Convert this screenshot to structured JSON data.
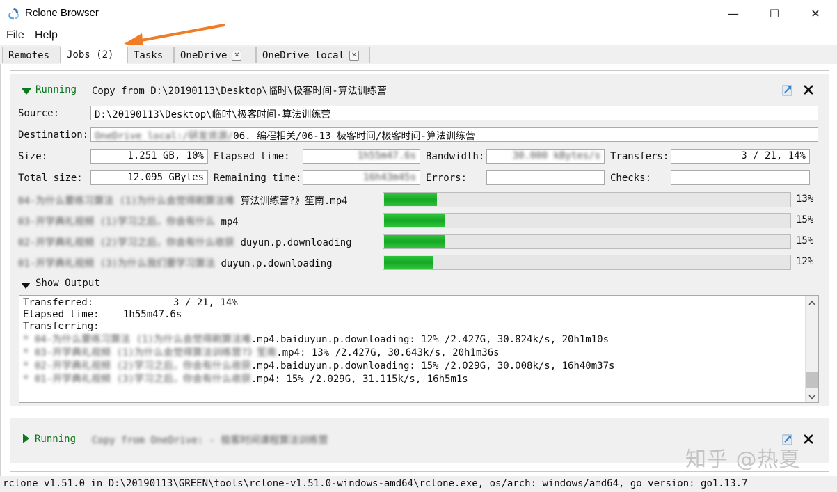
{
  "window": {
    "title": "Rclone Browser",
    "controls": [
      "—",
      "☐",
      "✕"
    ]
  },
  "menu": [
    {
      "label": "File",
      "accel": "F"
    },
    {
      "label": "Help",
      "accel": "H"
    }
  ],
  "tabs": [
    {
      "label": "Remotes",
      "closable": false,
      "active": false
    },
    {
      "label": "Jobs (2)",
      "closable": false,
      "active": true
    },
    {
      "label": "Tasks",
      "closable": false,
      "active": false
    },
    {
      "label": "OneDrive",
      "closable": true,
      "active": false
    },
    {
      "label": "OneDrive_local",
      "closable": true,
      "active": false
    }
  ],
  "colors": {
    "running_green": "#0a7a1d",
    "progress_green": "#15a824",
    "annotation_arrow": "#f07c26"
  },
  "job1": {
    "status": "Running",
    "title": "Copy from D:\\20190113\\Desktop\\临时\\极客时间-算法训练营",
    "source_label": "Source:",
    "source": "D:\\20190113\\Desktop\\临时\\极客时间-算法训练营",
    "destination_label": "Destination:",
    "destination_blurred": "OneDrive_local:/研发资源/",
    "destination": "06. 编程相关/06-13 极客时间/极客时间-算法训练营",
    "size_label": "Size:",
    "size": "1.251 GB, 10%",
    "elapsed_label": "Elapsed time:",
    "elapsed_blurred": "1h55m47.6s",
    "bandwidth_label": "Bandwidth:",
    "bandwidth_blurred": "30.000 kBytes/s",
    "transfers_label": "Transfers:",
    "transfers": "3 / 21, 14%",
    "total_size_label": "Total size:",
    "total_size": "12.095 GBytes",
    "remaining_label": "Remaining time:",
    "remaining_blurred": "16h43m45s",
    "errors_label": "Errors:",
    "errors": "",
    "checks_label": "Checks:",
    "checks": "",
    "files": [
      {
        "blurred": "04-为什么要练习算法 (1)为什么会觉得刷算法难",
        "visible": "算法训练营?》笙南.mp4",
        "progress": 13,
        "pct": "13%"
      },
      {
        "blurred": "03-开学典礼视频 (1)学习之后，你会有什么",
        "visible": "mp4",
        "progress": 15,
        "pct": "15%"
      },
      {
        "blurred": "02-开学典礼视频 (2)学习之后，你会有什么收获",
        "visible": "duyun.p.downloading",
        "progress": 15,
        "pct": "15%"
      },
      {
        "blurred": "01-开学典礼视频 (3)为什么我们要学习算法",
        "visible": "duyun.p.downloading",
        "progress": 12,
        "pct": "12%"
      }
    ],
    "show_output_label": "Show Output",
    "output": {
      "transferred_label": "Transferred:",
      "transferred_value": "3 / 21, 14%",
      "elapsed_label": "Elapsed time:",
      "elapsed_value": "1h55m47.6s",
      "transferring_label": "Transferring:",
      "lines": [
        {
          "blurred": "* 04-为什么要练习算法 (1)为什么会觉得刷算法难",
          "visible": ".mp4.baiduyun.p.downloading: 12% /2.427G, 30.824k/s, 20h1m10s"
        },
        {
          "blurred": "* 03-开学典礼视频 (1)为什么会觉得算法训练营?》笙南",
          "visible": ".mp4: 13% /2.427G, 30.643k/s, 20h1m36s"
        },
        {
          "blurred": "* 02-开学典礼视频 (2)学习之后，你会有什么收获",
          "visible": ".mp4.baiduyun.p.downloading: 15% /2.029G, 30.008k/s, 16h40m37s"
        },
        {
          "blurred": "* 01-开学典礼视频 (3)学习之后，你会有什么收获",
          "visible": ".mp4: 15% /2.029G, 31.115k/s, 16h5m1s"
        }
      ]
    }
  },
  "job2": {
    "status": "Running",
    "title_blurred": "Copy from OneDrive: - 极客时间课程算法训练营"
  },
  "statusbar": "rclone v1.51.0 in D:\\20190113\\GREEN\\tools\\rclone-v1.51.0-windows-amd64\\rclone.exe, os/arch: windows/amd64, go version: go1.13.7",
  "watermark": "知乎 @热夏"
}
